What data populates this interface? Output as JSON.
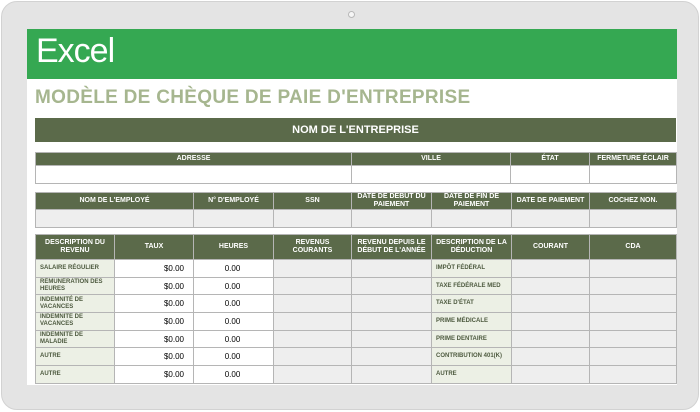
{
  "app": {
    "logo_text": "Excel"
  },
  "template": {
    "title": "MODÈLE DE CHÈQUE DE PAIE D'ENTREPRISE",
    "company_header": "NOM DE L'ENTREPRISE"
  },
  "address_table": {
    "headers": [
      "ADRESSE",
      "VILLE",
      "ÉTAT",
      "FERMETURE ÉCLAIR"
    ]
  },
  "employee_table": {
    "headers": [
      "NOM DE L'EMPLOYÉ",
      "N° D'EMPLOYÉ",
      "SSN",
      "DATE DE DÉBUT DU PAIEMENT",
      "DATE DE FIN DE PAIEMENT",
      "DATE DE PAIEMENT",
      "COCHEZ NON."
    ]
  },
  "earnings_table": {
    "headers": [
      "DESCRIPTION DU REVENU",
      "TAUX",
      "HEURES",
      "REVENUS COURANTS",
      "REVENU DEPUIS LE DÉBUT DE L'ANNÉE",
      "DESCRIPTION DE LA DÉDUCTION",
      "COURANT",
      "CDA"
    ],
    "rows": [
      {
        "earning": "SALAIRE RÉGULIER",
        "rate": "$0.00",
        "hours": "0.00",
        "deduction": "IMPÔT FÉDÉRAL"
      },
      {
        "earning": "RÉMUNÉRATION DES HEURES",
        "rate": "$0.00",
        "hours": "0.00",
        "deduction": "TAXE FÉDÉRALE MED"
      },
      {
        "earning": "INDEMNITÉ DE VACANCES",
        "rate": "$0.00",
        "hours": "0.00",
        "deduction": "TAXE D'ÉTAT"
      },
      {
        "earning": "INDEMNITÉ DE VACANCES",
        "rate": "$0.00",
        "hours": "0.00",
        "deduction": "PRIME MÉDICALE"
      },
      {
        "earning": "INDEMNITÉ DE MALADIE",
        "rate": "$0.00",
        "hours": "0.00",
        "deduction": "PRIME DENTAIRE"
      },
      {
        "earning": "AUTRE",
        "rate": "$0.00",
        "hours": "0.00",
        "deduction": "CONTRIBUTION 401(K)"
      },
      {
        "earning": "AUTRE",
        "rate": "$0.00",
        "hours": "0.00",
        "deduction": "AUTRE"
      }
    ]
  },
  "colors": {
    "banner": "#35a852",
    "header_fill": "#5b6a4a",
    "title_text": "#a6b68f",
    "label_fill": "#ecf0e5"
  }
}
